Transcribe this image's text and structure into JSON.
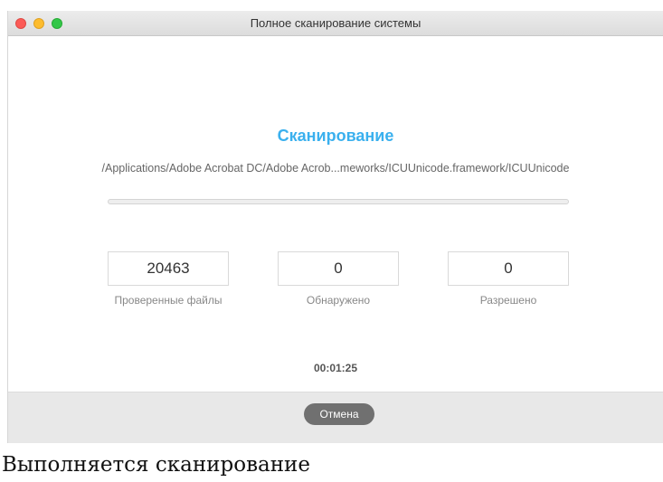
{
  "window": {
    "title": "Полное сканирование системы",
    "controls": [
      "close",
      "minimize",
      "zoom"
    ]
  },
  "scan": {
    "heading": "Сканирование",
    "current_path": "/Applications/Adobe Acrobat DC/Adobe Acrob...meworks/ICUUnicode.framework/ICUUnicode",
    "progress": 0
  },
  "stats": [
    {
      "value": "20463",
      "label": "Проверенные файлы"
    },
    {
      "value": "0",
      "label": "Обнаружено"
    },
    {
      "value": "0",
      "label": "Разрешено"
    }
  ],
  "timer": "00:01:25",
  "footer": {
    "cancel_label": "Отмена"
  },
  "caption": "Выполняется сканирование",
  "colors": {
    "accent": "#3ab0ee",
    "button": "#707070",
    "footer_bg": "#e8e8e8"
  }
}
